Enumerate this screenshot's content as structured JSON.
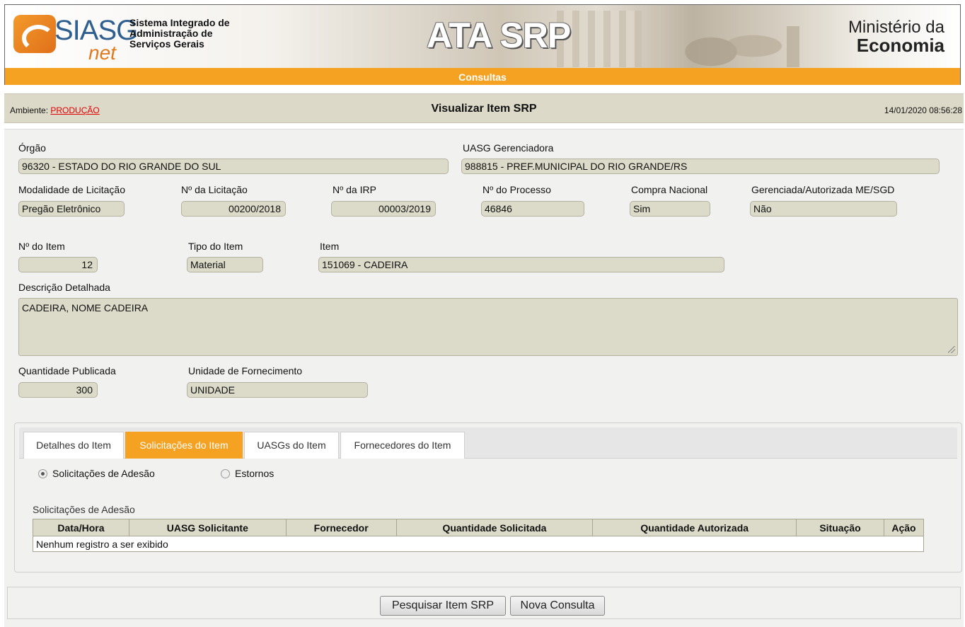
{
  "header": {
    "logo_siasg": "SIASG",
    "logo_net": "net",
    "system_name": [
      "Sistema Integrado de",
      "Administração de",
      "Serviços Gerais"
    ],
    "module_title": "ATA SRP",
    "ministry_line1": "Ministério da",
    "ministry_line2": "Economia"
  },
  "menu": {
    "label": "Consultas"
  },
  "info_bar": {
    "env_label": "Ambiente:",
    "env_value": "PRODUÇÃO",
    "title": "Visualizar Item SRP",
    "datetime": "14/01/2020 08:56:28"
  },
  "form": {
    "orgao": {
      "label": "Órgão",
      "value": "96320 - ESTADO DO RIO GRANDE DO SUL"
    },
    "uasg": {
      "label": "UASG Gerenciadora",
      "value": "988815 - PREF.MUNICIPAL DO RIO GRANDE/RS"
    },
    "modalidade": {
      "label": "Modalidade de Licitação",
      "value": "Pregão Eletrônico"
    },
    "num_licitacao": {
      "label": "Nº da Licitação",
      "value": "00200/2018"
    },
    "num_irp": {
      "label": "Nº da IRP",
      "value": "00003/2019"
    },
    "num_processo": {
      "label": "Nº do Processo",
      "value": "46846"
    },
    "compra_nacional": {
      "label": "Compra Nacional",
      "value": "Sim"
    },
    "gerenciada": {
      "label": "Gerenciada/Autorizada ME/SGD",
      "value": "Não"
    },
    "num_item": {
      "label": "Nº do Item",
      "value": "12"
    },
    "tipo_item": {
      "label": "Tipo do Item",
      "value": "Material"
    },
    "item": {
      "label": "Item",
      "value": "151069 - CADEIRA"
    },
    "descricao": {
      "label": "Descrição Detalhada",
      "value": "CADEIRA, NOME CADEIRA"
    },
    "quantidade": {
      "label": "Quantidade Publicada",
      "value": "300"
    },
    "unidade": {
      "label": "Unidade de Fornecimento",
      "value": "UNIDADE"
    }
  },
  "tabs": [
    {
      "label": "Detalhes do Item",
      "active": false
    },
    {
      "label": "Solicitações do Item",
      "active": true
    },
    {
      "label": "UASGs do Item",
      "active": false
    },
    {
      "label": "Fornecedores do Item",
      "active": false
    }
  ],
  "radios": [
    {
      "label": "Solicitações de Adesão",
      "selected": true
    },
    {
      "label": "Estornos",
      "selected": false
    }
  ],
  "table": {
    "caption": "Solicitações de Adesão",
    "columns": [
      "Data/Hora",
      "UASG Solicitante",
      "Fornecedor",
      "Quantidade Solicitada",
      "Quantidade Autorizada",
      "Situação",
      "Ação"
    ],
    "empty_message": "Nenhum registro a ser exibido"
  },
  "buttons": {
    "search": "Pesquisar Item SRP",
    "new_query": "Nova Consulta"
  },
  "colors": {
    "accent": "#f5a122",
    "field_bg": "#dcdac9",
    "env_value": "#e00000"
  }
}
